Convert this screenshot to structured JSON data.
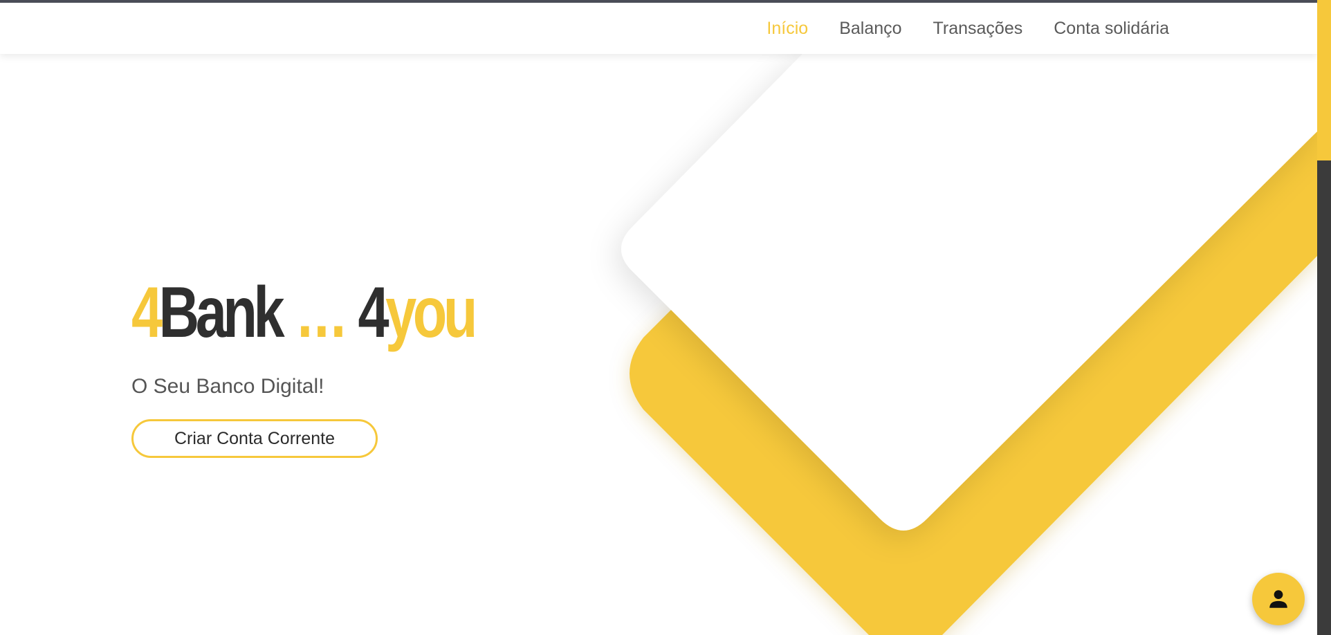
{
  "nav": {
    "items": [
      {
        "label": "Início",
        "active": true
      },
      {
        "label": "Balanço",
        "active": false
      },
      {
        "label": "Transações",
        "active": false
      },
      {
        "label": "Conta solidária",
        "active": false
      }
    ]
  },
  "hero": {
    "brand": {
      "part1_accent": "4",
      "part1_main": "Bank",
      "separator": "...",
      "part2_main": "4",
      "part2_accent": "you"
    },
    "tagline": "O Seu Banco Digital!",
    "cta_label": "Criar Conta Corrente"
  },
  "fab": {
    "icon": "person-icon"
  },
  "colors": {
    "accent": "#f6c83b",
    "dark": "#2f2f2f",
    "nav_text": "#5a5a5a",
    "scrollbar_track": "#3b3b3b"
  }
}
